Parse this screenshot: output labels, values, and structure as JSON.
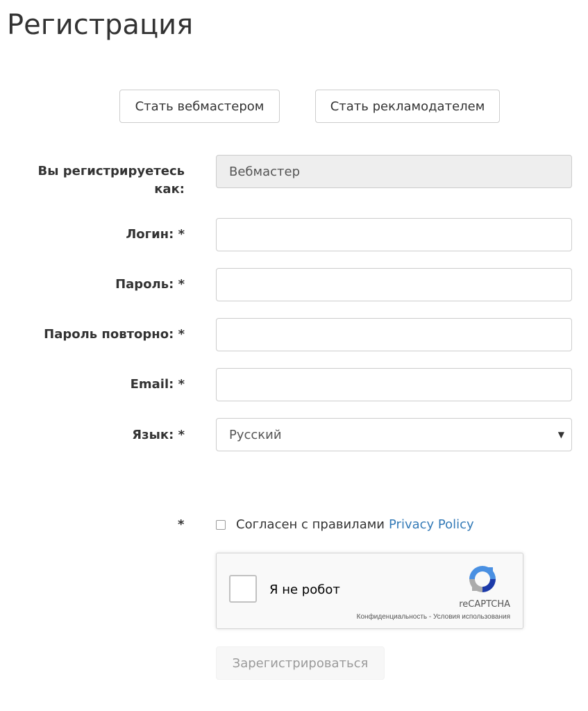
{
  "page": {
    "title": "Регистрация"
  },
  "roles": {
    "webmaster_label": "Стать вебмастером",
    "advertiser_label": "Стать рекламодателем"
  },
  "form": {
    "role": {
      "label_line1": "Вы регистрируетесь",
      "label_line2": "как:",
      "value": "Вебмастер"
    },
    "login": {
      "label": "Логин: *",
      "value": ""
    },
    "password": {
      "label": "Пароль: *",
      "value": ""
    },
    "password_repeat": {
      "label": "Пароль повторно: *",
      "value": ""
    },
    "email": {
      "label": "Email: *",
      "value": ""
    },
    "language": {
      "label": "Язык: *",
      "value": "Русский"
    }
  },
  "agreement": {
    "required_mark": "*",
    "text": "Согласен с правилами",
    "link_text": "Privacy Policy",
    "checked": false
  },
  "recaptcha": {
    "label": "Я не робот",
    "brand": "reCAPTCHA",
    "privacy": "Конфиденциальность",
    "separator": " - ",
    "terms": "Условия использования",
    "icon": "recaptcha-logo-icon"
  },
  "submit": {
    "label": "Зарегистрироваться",
    "disabled": true
  },
  "colors": {
    "link": "#337ab7",
    "border": "#cccccc",
    "readonly_bg": "#eeeeee",
    "text": "#333333"
  }
}
